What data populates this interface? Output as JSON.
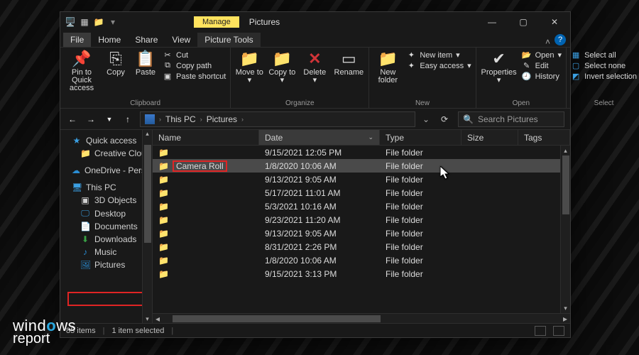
{
  "window": {
    "context_tab": "Manage",
    "title": "Pictures",
    "tabs": {
      "file": "File",
      "home": "Home",
      "share": "Share",
      "view": "View",
      "picture_tools": "Picture Tools"
    },
    "controls": {
      "min": "—",
      "max": "▢",
      "close": "✕"
    }
  },
  "ribbon": {
    "clipboard": {
      "label": "Clipboard",
      "pin": "Pin to Quick access",
      "copy": "Copy",
      "paste": "Paste",
      "cut": "Cut",
      "copy_path": "Copy path",
      "paste_shortcut": "Paste shortcut"
    },
    "organize": {
      "label": "Organize",
      "move_to": "Move to",
      "copy_to": "Copy to",
      "delete": "Delete",
      "rename": "Rename"
    },
    "new": {
      "label": "New",
      "new_folder": "New folder",
      "new_item": "New item",
      "easy_access": "Easy access"
    },
    "open": {
      "label": "Open",
      "properties": "Properties",
      "open": "Open",
      "edit": "Edit",
      "history": "History"
    },
    "select": {
      "label": "Select",
      "select_all": "Select all",
      "select_none": "Select none",
      "invert": "Invert selection"
    }
  },
  "address": {
    "crumb1": "This PC",
    "crumb2": "Pictures",
    "search_placeholder": "Search Pictures"
  },
  "sidebar": {
    "quick_access": "Quick access",
    "creative_cloud": "Creative Cloud File",
    "onedrive": "OneDrive - Person",
    "this_pc": "This PC",
    "threed": "3D Objects",
    "desktop": "Desktop",
    "documents": "Documents",
    "downloads": "Downloads",
    "music": "Music",
    "pictures": "Pictures"
  },
  "columns": {
    "name": "Name",
    "date": "Date",
    "type": "Type",
    "size": "Size",
    "tags": "Tags"
  },
  "rows": [
    {
      "name": "",
      "date": "9/15/2021 12:05 PM",
      "type": "File folder",
      "selected": false
    },
    {
      "name": "Camera Roll",
      "date": "1/8/2020 10:06 AM",
      "type": "File folder",
      "selected": true
    },
    {
      "name": "",
      "date": "9/13/2021 9:05 AM",
      "type": "File folder",
      "selected": false
    },
    {
      "name": "",
      "date": "5/17/2021 11:01 AM",
      "type": "File folder",
      "selected": false
    },
    {
      "name": "",
      "date": "5/3/2021 10:16 AM",
      "type": "File folder",
      "selected": false
    },
    {
      "name": "",
      "date": "9/23/2021 11:20 AM",
      "type": "File folder",
      "selected": false
    },
    {
      "name": "",
      "date": "9/13/2021 9:05 AM",
      "type": "File folder",
      "selected": false
    },
    {
      "name": "",
      "date": "8/31/2021 2:26 PM",
      "type": "File folder",
      "selected": false
    },
    {
      "name": "",
      "date": "1/8/2020 10:06 AM",
      "type": "File folder",
      "selected": false
    },
    {
      "name": "",
      "date": "9/15/2021 3:13 PM",
      "type": "File folder",
      "selected": false
    }
  ],
  "status": {
    "items": "85 items",
    "selected": "1 item selected"
  },
  "watermark": {
    "line1_pre": "wind",
    "line1_accent": "o",
    "line1_post": "ws",
    "line2": "report"
  }
}
